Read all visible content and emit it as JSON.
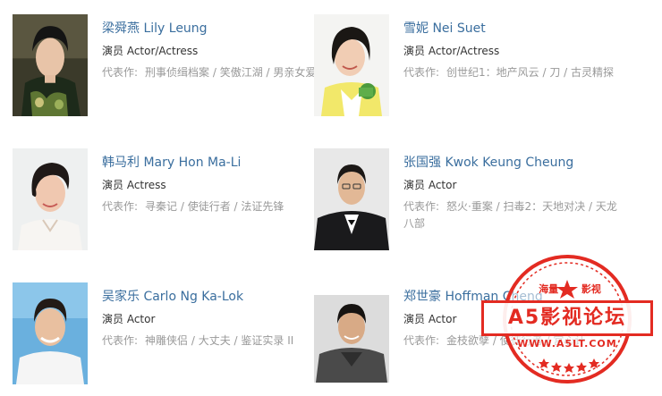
{
  "cast": [
    {
      "name": "梁舜燕 Lily Leung",
      "role": "演员 Actor/Actress",
      "works_label": "代表作:",
      "works": "刑事侦缉档案 / 笑傲江湖 / 男亲女爱"
    },
    {
      "name": "雪妮 Nei Suet",
      "role": "演员 Actor/Actress",
      "works_label": "代表作:",
      "works": "创世纪1：地产风云 / 刀 / 古灵精探"
    },
    {
      "name": "韩马利 Mary Hon Ma-Li",
      "role": "演员 Actress",
      "works_label": "代表作:",
      "works": "寻秦记 / 使徒行者 / 法证先锋"
    },
    {
      "name": "张国强 Kwok Keung Cheung",
      "role": "演员 Actor",
      "works_label": "代表作:",
      "works": "怒火·重案 / 扫毒2：天地对决 / 天龙八部"
    },
    {
      "name": "吴家乐 Carlo Ng Ka-Lok",
      "role": "演员 Actor",
      "works_label": "代表作:",
      "works": "神雕侠侣 / 大丈夫 / 鉴证实录 II"
    },
    {
      "name": "郑世豪 Hoffman Cheng",
      "role": "演员 Actor",
      "works_label": "代表作:",
      "works": "金枝欲孽 / 使徒行者 / 宫心计"
    }
  ],
  "stamp": {
    "top_left": "海量",
    "top_right": "影视",
    "banner": "A5影视论坛",
    "url": "WWW.A5LT.COM"
  },
  "colors": {
    "name_link": "#3a6e9e",
    "role_text": "#333333",
    "works_text": "#999999",
    "stamp_red": "#e32b22"
  }
}
